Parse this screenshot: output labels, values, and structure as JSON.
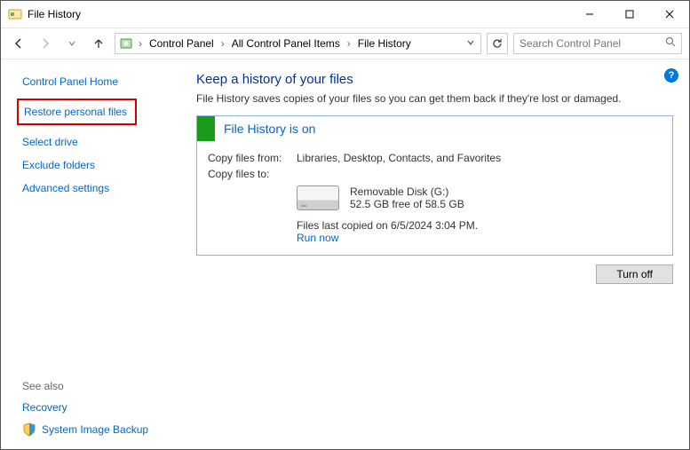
{
  "window": {
    "title": "File History"
  },
  "breadcrumbs": {
    "a": "Control Panel",
    "b": "All Control Panel Items",
    "c": "File History"
  },
  "search": {
    "placeholder": "Search Control Panel"
  },
  "sidebar": {
    "home": "Control Panel Home",
    "restore": "Restore personal files",
    "select_drive": "Select drive",
    "exclude": "Exclude folders",
    "advanced": "Advanced settings"
  },
  "seealso": {
    "header": "See also",
    "recovery": "Recovery",
    "sib": "System Image Backup"
  },
  "main": {
    "heading": "Keep a history of your files",
    "subtitle": "File History saves copies of your files so you can get them back if they're lost or damaged.",
    "status_title": "File History is on",
    "copy_from_label": "Copy files from:",
    "copy_from_value": "Libraries, Desktop, Contacts, and Favorites",
    "copy_to_label": "Copy files to:",
    "drive_name": "Removable Disk (G:)",
    "drive_free": "52.5 GB free of 58.5 GB",
    "last_copied": "Files last copied on 6/5/2024 3:04 PM.",
    "run_now": "Run now",
    "turn_off": "Turn off"
  }
}
